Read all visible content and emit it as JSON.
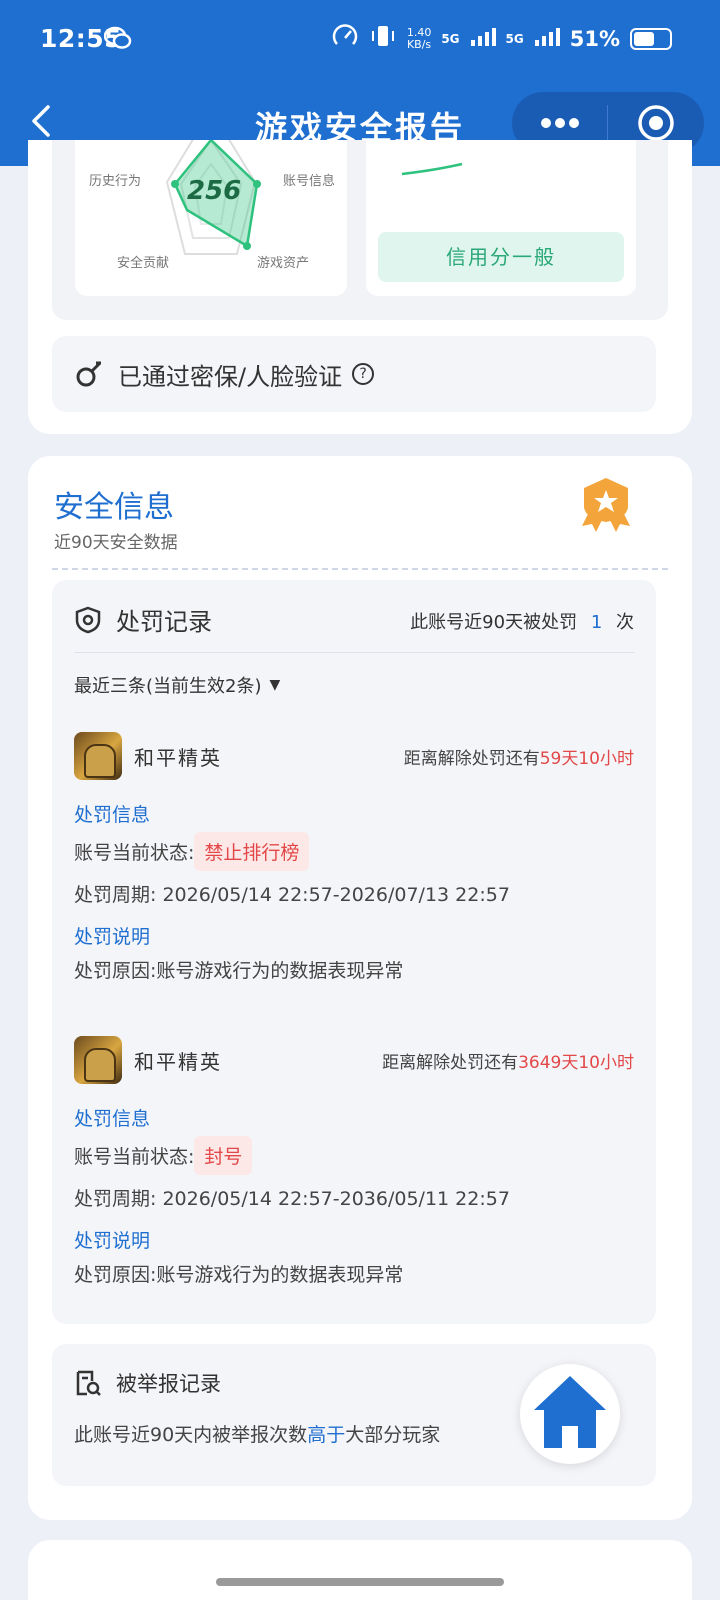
{
  "status_bar": {
    "time": "12:55",
    "net_speed": "1.40\nKB/s",
    "sig1": "5G",
    "sig2": "5G",
    "battery": "51%"
  },
  "header": {
    "title": "游戏安全报告"
  },
  "radar": {
    "score": "256",
    "labels": {
      "top_left": "历史行为",
      "top_right": "账号信息",
      "bottom_left": "安全贡献",
      "bottom_right": "游戏资产"
    }
  },
  "credit": {
    "label": "信用分一般"
  },
  "verify": {
    "text": "已通过密保/人脸验证",
    "help": "?"
  },
  "security_info": {
    "title": "安全信息",
    "subtitle": "近90天安全数据"
  },
  "punishment": {
    "title": "处罚记录",
    "summary_prefix": "此账号近90天被处罚",
    "summary_count": "1",
    "summary_suffix": "次",
    "filter": "最近三条(当前生效2条)",
    "filter_icon": "▼",
    "records": [
      {
        "game": "和平精英",
        "countdown_prefix": "距离解除处罚还有",
        "countdown": "59天10小时",
        "info_title": "处罚信息",
        "status_label": "账号当前状态:",
        "status": "禁止排行榜",
        "period_label": "处罚周期:",
        "period": "2026/05/14 22:57-2026/07/13 22:57",
        "desc_title": "处罚说明",
        "reason": "处罚原因:账号游戏行为的数据表现异常"
      },
      {
        "game": "和平精英",
        "countdown_prefix": "距离解除处罚还有",
        "countdown": "3649天10小时",
        "info_title": "处罚信息",
        "status_label": "账号当前状态:",
        "status": "封号",
        "period_label": "处罚周期:",
        "period": "2026/05/14 22:57-2036/05/11 22:57",
        "desc_title": "处罚说明",
        "reason": "处罚原因:账号游戏行为的数据表现异常"
      }
    ]
  },
  "report": {
    "title": "被举报记录",
    "text_prefix": "此账号近90天内被举报次数",
    "text_highlight": "高于",
    "text_suffix": "大部分玩家"
  },
  "colors": {
    "primary": "#1f6fd1",
    "danger": "#e24848",
    "credit_bg": "#dff5ee",
    "credit_text": "#2aa878",
    "radar": "#2ec27e"
  }
}
